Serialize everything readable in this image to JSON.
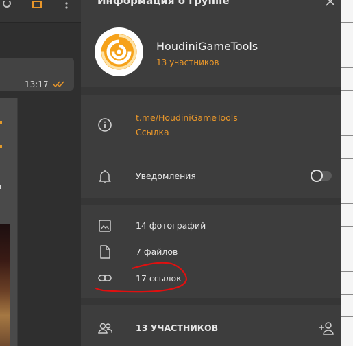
{
  "chat": {
    "message_time": "13:17"
  },
  "panel": {
    "title": "Информация о группе",
    "group_name": "HoudiniGameTools",
    "member_count": "13 участников",
    "link_url": "t.me/HoudiniGameTools",
    "link_caption": "Ссылка",
    "notifications_label": "Уведомления",
    "notifications_enabled": false,
    "media": {
      "photos": "14 фотографий",
      "files": "7 файлов",
      "links": "17 ссылок"
    },
    "members_header": "13 УЧАСТНИКОВ"
  },
  "colors": {
    "accent": "#e8962a",
    "panel_bg": "#3d3d3d",
    "annotation": "#e01010"
  },
  "icons": [
    "info-icon",
    "bell-icon",
    "image-icon",
    "file-icon",
    "link-icon",
    "members-icon",
    "add-member-icon",
    "close-icon"
  ]
}
